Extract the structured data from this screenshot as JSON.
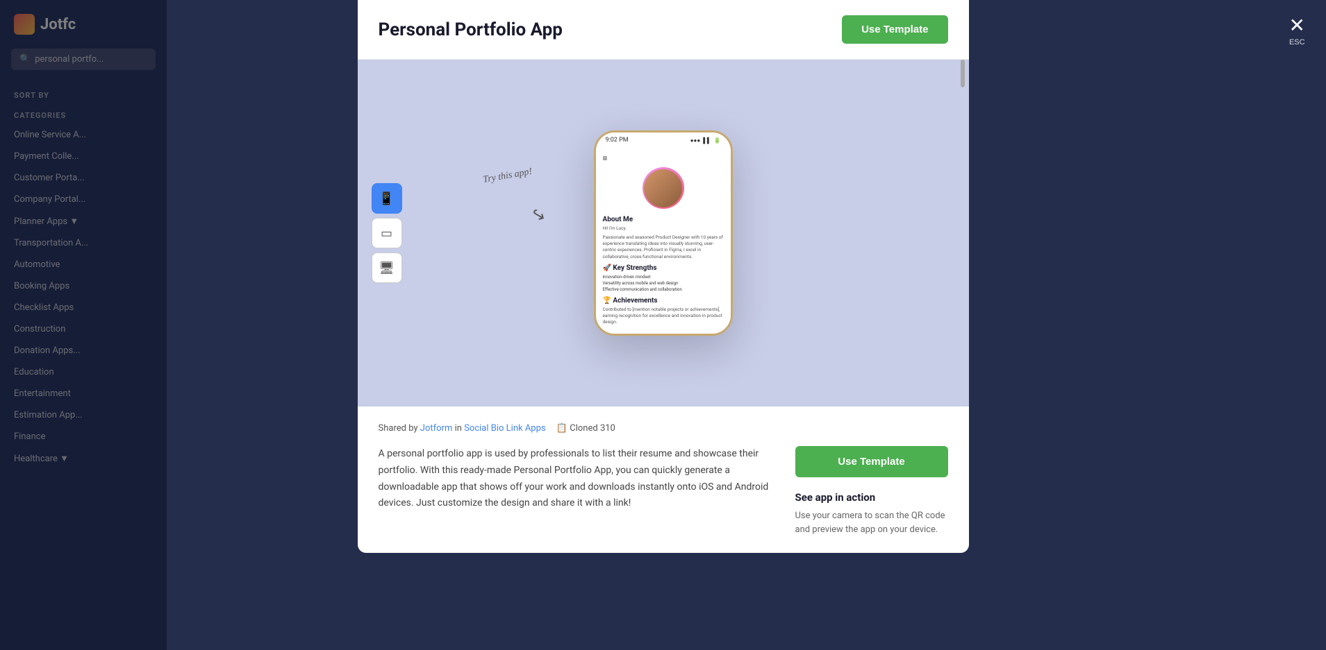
{
  "modal": {
    "title": "Personal Portfolio App",
    "use_template_label": "Use Template",
    "shared_by_text": "Shared by",
    "shared_by_author": "Jotform",
    "in_text": "in",
    "category_link": "Social Bio Link Apps",
    "cloned_icon": "📋",
    "cloned_text": "Cloned",
    "cloned_count": "310",
    "description": "A personal portfolio app is used by professionals to list their resume and showcase their portfolio. With this ready-made Personal Portfolio App, you can quickly generate a downloadable app that shows off your work and downloads instantly onto iOS and Android devices. Just customize the design and share it with a link!",
    "use_template_main_label": "Use Template",
    "see_in_action_title": "See app in action",
    "see_in_action_desc": "Use your camera to scan the QR code and preview the app on your device."
  },
  "phone": {
    "status_time": "9:02 PM",
    "status_dots": "●●●",
    "about_me_title": "About Me",
    "greeting": "Hi! I'm Lucy.",
    "bio": "Passionate and seasoned Product Designer with 10 years of experience translating ideas into visually stunning, user-centric experiences. Proficient in Figma, I excel in collaborative, cross-functional environments.",
    "strengths_title": "🚀 Key Strengths",
    "strength_1": "Innovation-driven mindset",
    "strength_2": "Versatility across mobile and web design",
    "strength_3": "Effective communication and collaboration",
    "achievements_title": "🏆 Achievements",
    "achievements_text": "Contributed to [mention notable projects or achievements], earning recognition for excellence and innovation in product design."
  },
  "device_selector": {
    "mobile_label": "Mobile",
    "tablet_label": "Tablet",
    "desktop_label": "Desktop"
  },
  "try_annotation": "Try this app!",
  "close_label": "✕",
  "esc_label": "ESC",
  "sidebar": {
    "logo_text": "Jotfc",
    "search_placeholder": "personal portfo...",
    "sort_by_label": "SORT BY",
    "categories_label": "CATEGORIES",
    "items": [
      "Online Service A...",
      "Payment Colle...",
      "Customer Porta...",
      "Company Portal...",
      "Planner Apps ▼",
      "Transportation A...",
      "Automotive",
      "Booking Apps",
      "Checklist Apps",
      "Construction",
      "Donation Apps...",
      "Education",
      "Entertainment",
      "Estimation App...",
      "Finance",
      "Healthcare ▼"
    ]
  }
}
